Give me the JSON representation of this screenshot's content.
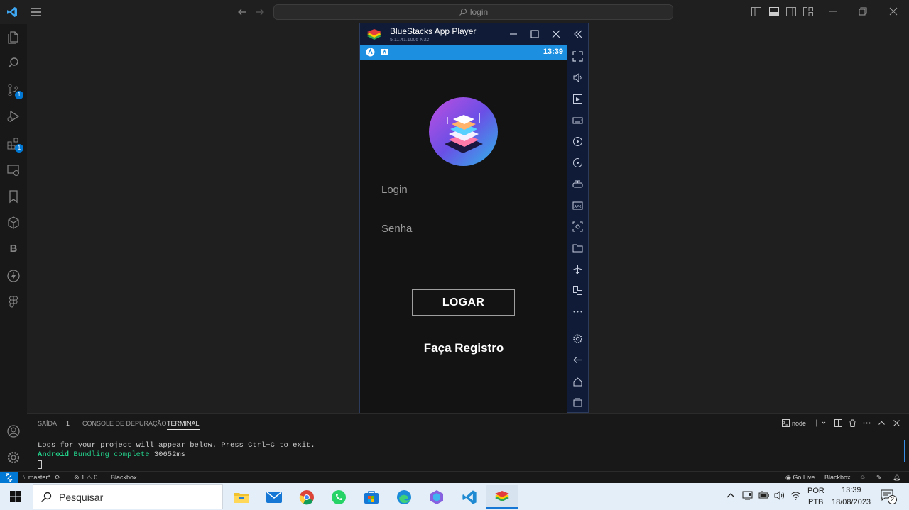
{
  "vscode": {
    "command_center": "login",
    "badges": {
      "source_control": "1",
      "extensions": "1"
    },
    "activity_letter": "B"
  },
  "bluestacks": {
    "title": "BlueStacks App Player",
    "version": "5.11.41.1005  N32"
  },
  "android": {
    "time": "13:39",
    "login_placeholder": "Login",
    "password_placeholder": "Senha",
    "login_button": "LOGAR",
    "register_link": "Faça Registro"
  },
  "panel": {
    "tabs": [
      {
        "label": "SAÍDA",
        "count": "1"
      },
      {
        "label": "CONSOLE DE DEPURAÇÃO"
      },
      {
        "label": "TERMINAL"
      }
    ],
    "terminal_profile": "node",
    "terminal_lines": {
      "line1": "Logs for your project will appear below. Press Ctrl+C to exit.",
      "line2_keyword": "Android",
      "line2_text": "Bundling complete",
      "line2_time": "30652ms"
    }
  },
  "statusbar": {
    "branch": "master*",
    "errors": "1",
    "warnings": "0",
    "theme": "Blackbox",
    "go_live": "Go Live",
    "right_theme": "Blackbox"
  },
  "taskbar": {
    "search_placeholder": "Pesquisar",
    "language": "POR",
    "layout": "PTB",
    "time": "13:39",
    "date": "18/08/2023",
    "notifications": "2"
  }
}
